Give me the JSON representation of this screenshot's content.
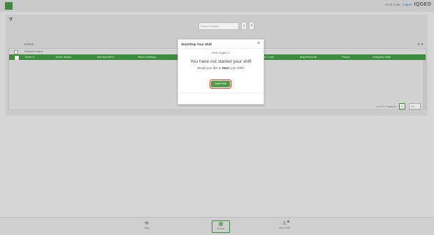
{
  "topbar": {
    "user_name": "Scott Ange",
    "logout_label": "Logout",
    "brand": "IQGEO",
    "accent": "#3c8a3c"
  },
  "search": {
    "placeholder": "Search Tickets",
    "icon": "search-icon",
    "clear_icon": "close-icon"
  },
  "card": {
    "label": "Tickets",
    "group_label": "Default Project"
  },
  "grid": {
    "columns": [
      "Ticket #",
      "Ticket Status",
      "Member/WFA",
      "Street Address",
      "Disaster Code",
      "Map/Record#",
      "Phone",
      "Assigned Date"
    ]
  },
  "pager": {
    "summary": "1-1 of 1 Page(s)",
    "page": "1",
    "page_size": "25 / ..."
  },
  "modal": {
    "title": "Start/Stop Your Shift",
    "greeting": "Hello, Angel C!",
    "heading": "You have not started your shift",
    "question_pre": "Would you like to ",
    "question_bold": "Start",
    "question_post": " your shift?",
    "button_label": "Start Shift"
  },
  "footer": {
    "items": [
      {
        "label": "Map",
        "icon": "globe-icon"
      },
      {
        "label": "Tickets",
        "icon": "tickets-icon"
      },
      {
        "label": "Start Shift",
        "icon": "person-icon"
      }
    ]
  }
}
